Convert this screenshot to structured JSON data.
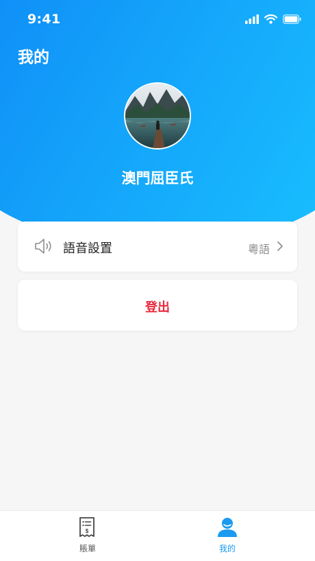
{
  "status_bar": {
    "time": "9:41"
  },
  "header": {
    "title": "我的"
  },
  "profile": {
    "name": "澳門屈臣氏"
  },
  "settings": {
    "voice_label": "語音設置",
    "voice_value": "粵語"
  },
  "logout": {
    "label": "登出"
  },
  "tab_bar": {
    "items": [
      {
        "label": "賬單",
        "icon": "receipt-icon",
        "active": false
      },
      {
        "label": "我的",
        "icon": "user-icon",
        "active": true
      }
    ]
  },
  "colors": {
    "accent": "#1a9bf0",
    "gradient_start": "#0a7cf5",
    "gradient_end": "#19c2ff",
    "logout": "#e8293b"
  }
}
